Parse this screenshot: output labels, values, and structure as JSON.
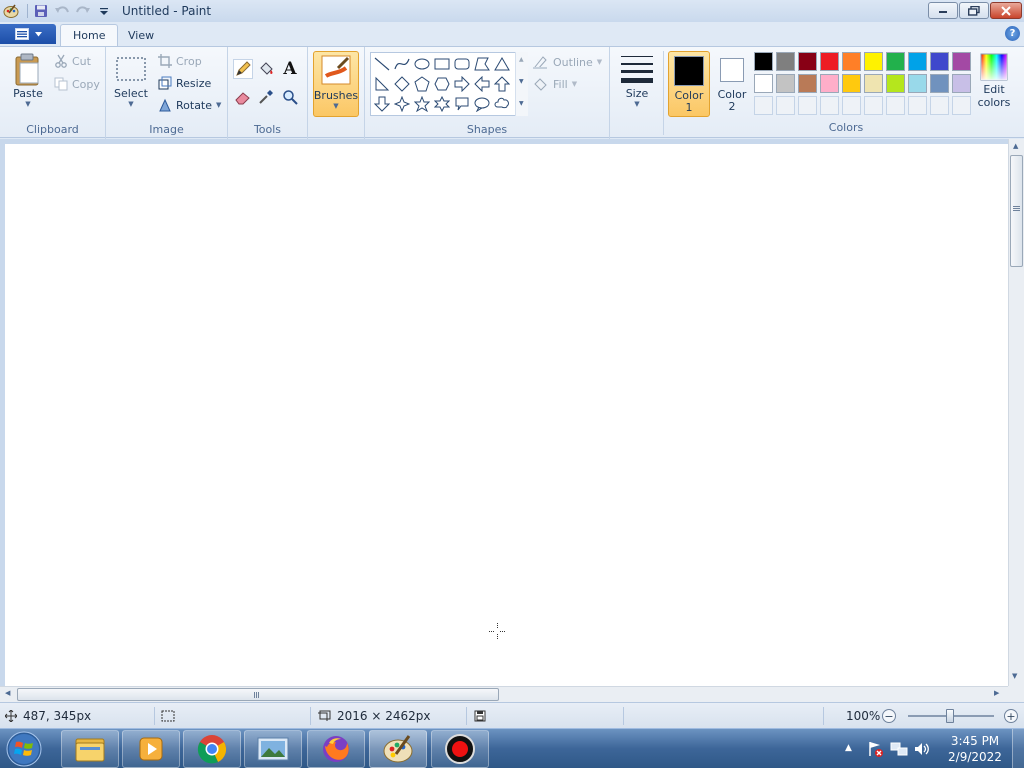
{
  "window": {
    "title": "Untitled - Paint",
    "controls": {
      "minimize": "minimize",
      "restore": "restore",
      "close": "close"
    }
  },
  "tabs": [
    {
      "label": "Home",
      "active": true
    },
    {
      "label": "View",
      "active": false
    }
  ],
  "ribbon": {
    "clipboard": {
      "label": "Clipboard",
      "paste": "Paste",
      "cut": "Cut",
      "copy": "Copy"
    },
    "image": {
      "label": "Image",
      "select": "Select",
      "crop": "Crop",
      "resize": "Resize",
      "rotate": "Rotate"
    },
    "tools": {
      "label": "Tools"
    },
    "brushes": {
      "label": "Brushes"
    },
    "shapes": {
      "label": "Shapes",
      "outline": "Outline",
      "fill": "Fill"
    },
    "size": {
      "label": "Size"
    },
    "colors": {
      "label": "Colors",
      "color1_label": "Color 1",
      "color1_line1": "Color",
      "color1_line2": "1",
      "color2_line1": "Color",
      "color2_line2": "2",
      "edit_line1": "Edit",
      "edit_line2": "colors",
      "color1_value": "#000000",
      "color2_value": "#ffffff",
      "palette_row1": [
        "#000000",
        "#7f7f7f",
        "#880015",
        "#ed1c24",
        "#ff7f27",
        "#fff200",
        "#22b14c",
        "#00a2e8",
        "#3f48cc",
        "#a349a4"
      ],
      "palette_row2": [
        "#ffffff",
        "#c3c3c3",
        "#b97a57",
        "#ffaec9",
        "#ffc90e",
        "#efe4b0",
        "#b5e61d",
        "#99d9ea",
        "#7092be",
        "#c8bfe7"
      ]
    }
  },
  "status": {
    "cursor_position": "487, 345px",
    "canvas_size": "2016 × 2462px",
    "zoom": "100%"
  },
  "taskbar": {
    "time": "3:45 PM",
    "date": "2/9/2022"
  }
}
